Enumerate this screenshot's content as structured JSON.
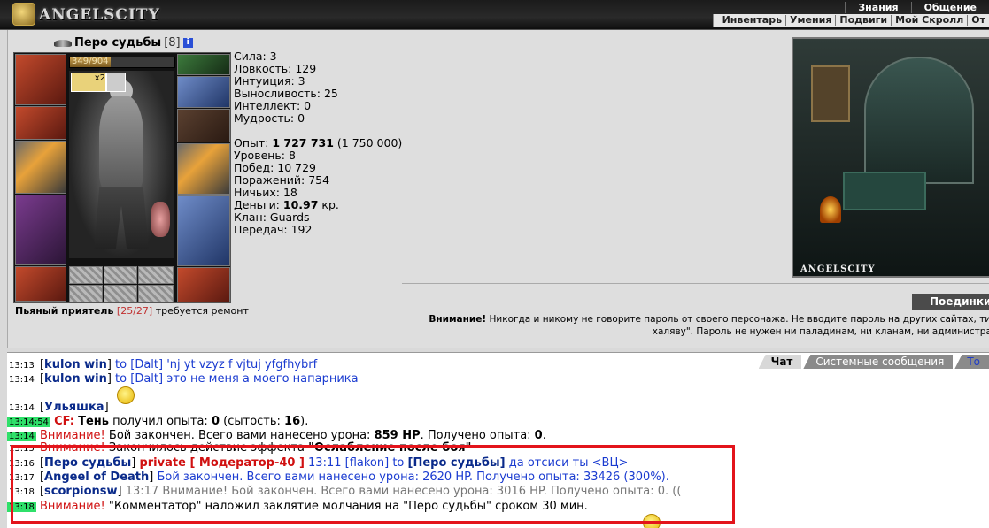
{
  "header": {
    "logo_text": "ANGELSCITY",
    "top_tabs": [
      "Знания",
      "Общение"
    ],
    "sub_menu": [
      "Инвентарь",
      "Умения",
      "Подвиги",
      "Мой Скролл",
      "От"
    ]
  },
  "character": {
    "name": "Перо судьбы",
    "level": "[8]",
    "info_icon": "i",
    "hp": "349/904",
    "hp_fraction": 0.386,
    "buff_count": "x2",
    "stats": {
      "strength": "Сила: 3",
      "agility": "Ловкость: 129",
      "intuition": "Интуиция: 3",
      "endurance": "Выносливость: 25",
      "intellect": "Интеллект: 0",
      "wisdom": "Мудрость: 0"
    },
    "experience_label": "Опыт: ",
    "experience_value": "1 727 731",
    "experience_next": " (1 750 000)",
    "level_line": "Уровень: 8",
    "wins": "Побед: 10 729",
    "losses": "Поражений: 754",
    "draws": "Ничьих: 18",
    "money_label": "Деньги: ",
    "money_value": "10.97",
    "money_unit": " кр.",
    "clan": "Клан: Guards",
    "transfers": "Передач: 192",
    "status_name": "Пьяный приятель",
    "status_count": "[25/27]",
    "status_note": " требуется ремонт"
  },
  "scene": {
    "brand": "ANGELSCITY"
  },
  "duel_button": "Поединки",
  "warning": {
    "bold": "Внимание!",
    "line1": " Никогда и никому не говорите пароль от своего персонажа. Не вводите пароль на других сайтах, тип",
    "line2": "халяву\". Пароль не нужен ни паладинам, ни кланам, ни администрат"
  },
  "chat": {
    "tabs": [
      "Чат",
      "Системные сообщения",
      "То"
    ],
    "lines": [
      {
        "time": "13:13",
        "nick": "kulon win",
        "to": " to ",
        "target": "[Dalt]",
        "text": " 'nj yt vzyz f vjtuj yfgfhybrf"
      },
      {
        "time": "13:14",
        "nick": "kulon win",
        "to": " to ",
        "target": "[Dalt]",
        "text": " это не меня а моего напарника"
      },
      {
        "time": "13:14",
        "nick": "Ульяшка"
      },
      {
        "time": "13:14:54",
        "label": "CF:",
        "name": "Тень",
        "text1": " получил опыта: ",
        "val1": "0",
        "text2": " (сытость: ",
        "val2": "16",
        "text3": ")."
      },
      {
        "time": "13:14",
        "warn": "Внимание!",
        "text1": " Бой закончен. Всего вами нанесено урона: ",
        "val1": "859 HP",
        "text2": ". Получено опыта: ",
        "val2": "0",
        "text3": "."
      },
      {
        "time": "13:15",
        "warn": "Внимание!",
        "text1": " Закончилось действие эффекта ",
        "val1": "\"Ослабление после боя\""
      },
      {
        "time": "13:16",
        "nick": "Перо судьбы",
        "private": "private [ Модератор-40 ]",
        "text": " 13:11 [flakon] to ",
        "target": "[Перо судьбы]",
        "text2": " да отсиси ты <ВЦ>"
      },
      {
        "time": "13:17",
        "nick": "Angeel of Death",
        "text": " Бой закончен. Всего вами нанесено урона: 2620 HP. Получено опыта: 33426 (300%)."
      },
      {
        "time": "13:18",
        "nick": "scorpionsw",
        "text": " 13:17 Внимание! Бой закончен. Всего вами нанесено урона: 3016 HP. Получено опыта: 0. (("
      },
      {
        "time": "13:18",
        "warn": "Внимание!",
        "text": " \"Комментатор\" наложил заклятие молчания на \"Перо судьбы\" сроком 30 мин."
      }
    ]
  }
}
